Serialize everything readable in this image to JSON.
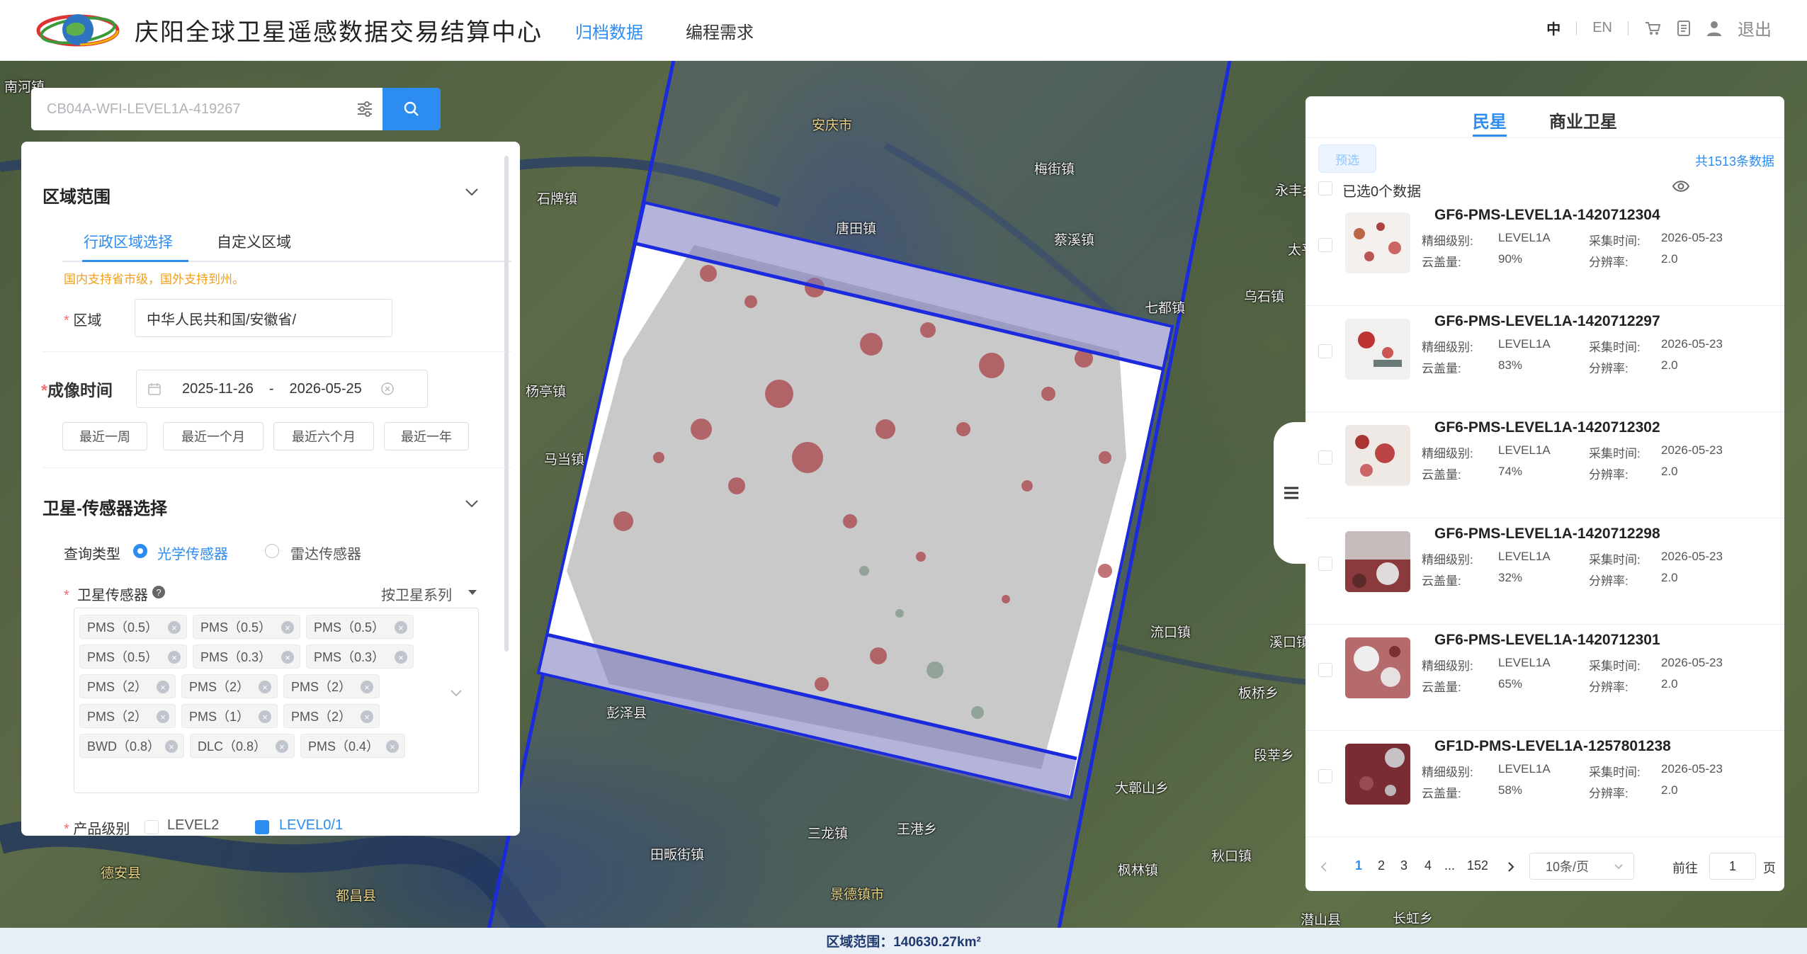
{
  "header": {
    "title": "庆阳全球卫星遥感数据交易结算中心",
    "nav": [
      "归档数据",
      "编程需求"
    ],
    "lang_zh": "中",
    "lang_en": "EN",
    "logout": "退出"
  },
  "search": {
    "placeholder": "CB04A-WFI-LEVEL1A-419267"
  },
  "filter": {
    "region_title": "区域范围",
    "tabs": [
      "行政区域选择",
      "自定义区域"
    ],
    "hint": "国内支持省市级，国外支持到州。",
    "region_label": "区域",
    "region_value": "中华人民共和国/安徽省/",
    "time_label": "成像时间",
    "date_start": "2025-11-26",
    "date_sep": "-",
    "date_end": "2026-05-25",
    "quick": [
      "最近一周",
      "最近一个月",
      "最近六个月",
      "最近一年"
    ],
    "sensor_title": "卫星-传感器选择",
    "query_type_label": "查询类型",
    "optical": "光学传感器",
    "radar": "雷达传感器",
    "sensor_label": "卫星传感器",
    "by_series": "按卫星系列",
    "tags": [
      "PMS（0.5）",
      "PMS（0.5）",
      "PMS（0.5）",
      "PMS（0.5）",
      "PMS（0.3）",
      "PMS（0.3）",
      "PMS（2）",
      "PMS（2）",
      "PMS（2）",
      "PMS（2）",
      "PMS（1）",
      "PMS（2）",
      "BWD（0.8）",
      "DLC（0.8）",
      "PMS（0.4）"
    ],
    "product_level_label": "产品级别",
    "level2": "LEVEL2",
    "level01": "LEVEL0/1"
  },
  "results": {
    "tabs": [
      "民星",
      "商业卫星"
    ],
    "preselect": "预选",
    "total": "共1513条数据",
    "selected": "已选0个数据",
    "labels": {
      "level": "精细级别:",
      "cloud": "云盖量:",
      "time": "采集时间:",
      "res": "分辨率:"
    },
    "items": [
      {
        "name": "GF6-PMS-LEVEL1A-1420712304",
        "level": "LEVEL1A",
        "cloud": "90%",
        "date": "2026-05-23",
        "res": "2.0"
      },
      {
        "name": "GF6-PMS-LEVEL1A-1420712297",
        "level": "LEVEL1A",
        "cloud": "83%",
        "date": "2026-05-23",
        "res": "2.0"
      },
      {
        "name": "GF6-PMS-LEVEL1A-1420712302",
        "level": "LEVEL1A",
        "cloud": "74%",
        "date": "2026-05-23",
        "res": "2.0"
      },
      {
        "name": "GF6-PMS-LEVEL1A-1420712298",
        "level": "LEVEL1A",
        "cloud": "32%",
        "date": "2026-05-23",
        "res": "2.0"
      },
      {
        "name": "GF6-PMS-LEVEL1A-1420712301",
        "level": "LEVEL1A",
        "cloud": "65%",
        "date": "2026-05-23",
        "res": "2.0"
      },
      {
        "name": "GF1D-PMS-LEVEL1A-1257801238",
        "level": "LEVEL1A",
        "cloud": "58%",
        "date": "2026-05-23",
        "res": "2.0"
      }
    ],
    "pagination": {
      "pages": [
        "1",
        "2",
        "3",
        "4",
        "...",
        "152"
      ],
      "page_size": "10条/页",
      "goto": "前往",
      "goto_value": "1",
      "page_unit": "页"
    }
  },
  "map_labels": [
    "南河镇",
    "安庆市",
    "石牌镇",
    "梅街镇",
    "唐田镇",
    "永丰乡",
    "太平湖",
    "乌石镇",
    "七都镇",
    "蔡溪镇",
    "杨亭镇",
    "马当镇",
    "流口镇",
    "溪口镇",
    "板桥乡",
    "段莘乡",
    "大鄣山乡",
    "三龙镇",
    "王港乡",
    "景德镇市",
    "田畈街镇",
    "秋口镇",
    "都昌县",
    "彭泽县",
    "长虹乡",
    "德安县",
    "潜山县",
    "枫林镇"
  ],
  "footer": {
    "area": "区域范围：140630.27km²"
  }
}
